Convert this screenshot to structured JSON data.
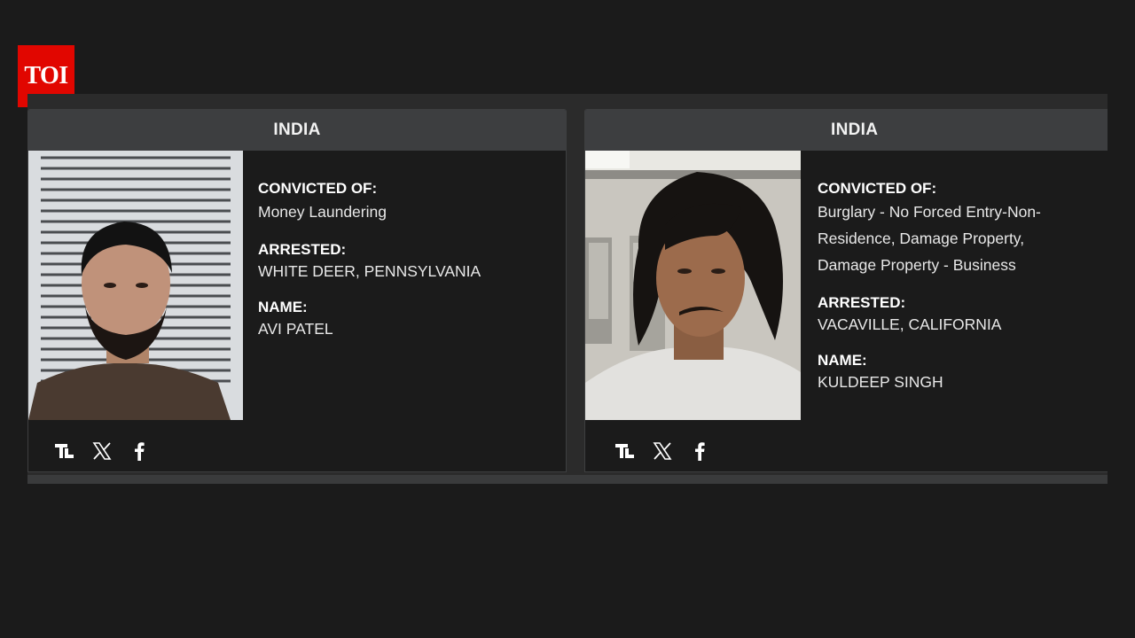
{
  "logo": {
    "text": "TOI",
    "bg": "#e10600"
  },
  "cards": [
    {
      "country": "INDIA",
      "convicted_label": "CONVICTED OF:",
      "convicted_value": "Money Laundering",
      "arrested_label": "ARRESTED:",
      "arrested_value": "WHITE DEER, PENNSYLVANIA",
      "name_label": "NAME:",
      "name_value": "AVI PATEL",
      "photo": "mugshot-photo",
      "social": [
        "tribune-icon",
        "x-icon",
        "facebook-icon"
      ]
    },
    {
      "country": "INDIA",
      "convicted_label": "CONVICTED OF:",
      "convicted_value": "Burglary - No Forced Entry-Non-Residence, Damage Property, Damage Property - Business",
      "arrested_label": "ARRESTED:",
      "arrested_value": "VACAVILLE, CALIFORNIA",
      "name_label": "NAME:",
      "name_value": "KULDEEP SINGH",
      "photo": "mugshot-photo",
      "social": [
        "tribune-icon",
        "x-icon",
        "facebook-icon"
      ]
    }
  ],
  "colors": {
    "background": "#1b1b1b",
    "card_header": "#3d3e40",
    "strip": "#2b2b2b"
  }
}
